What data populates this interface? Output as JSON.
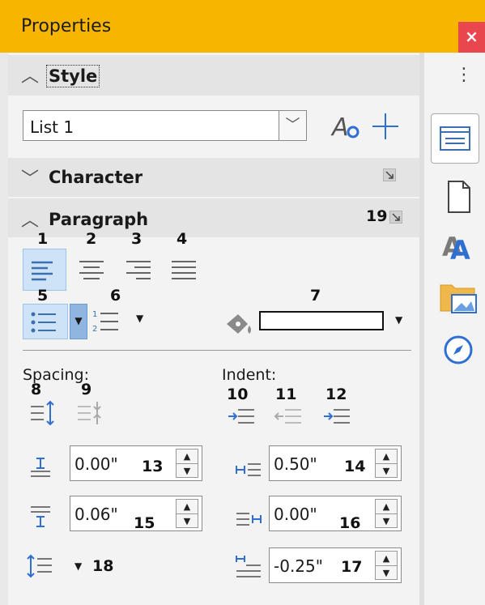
{
  "titlebar": {
    "title": "Properties",
    "close": "×"
  },
  "sections": {
    "style": {
      "label": "Style",
      "value": "List 1"
    },
    "character": {
      "label": "Character"
    },
    "paragraph": {
      "label": "Paragraph"
    }
  },
  "callouts": {
    "n1": "1",
    "n2": "2",
    "n3": "3",
    "n4": "4",
    "n5": "5",
    "n6": "6",
    "n7": "7",
    "n8": "8",
    "n9": "9",
    "n10": "10",
    "n11": "11",
    "n12": "12",
    "n13": "13",
    "n14": "14",
    "n15": "15",
    "n16": "16",
    "n17": "17",
    "n18": "18",
    "n19": "19"
  },
  "spacing": {
    "label": "Spacing:",
    "above": "0.00\"",
    "below": "0.06\""
  },
  "indent": {
    "label": "Indent:",
    "before": "0.50\"",
    "after": "0.00\"",
    "first_line": "-0.25\""
  },
  "sidebar": {
    "menu": "⋮"
  },
  "colors": {
    "titlebar": "#f7b500",
    "close": "#e8484d",
    "selected": "#cfe3f8",
    "accent": "#2f6fd1"
  }
}
